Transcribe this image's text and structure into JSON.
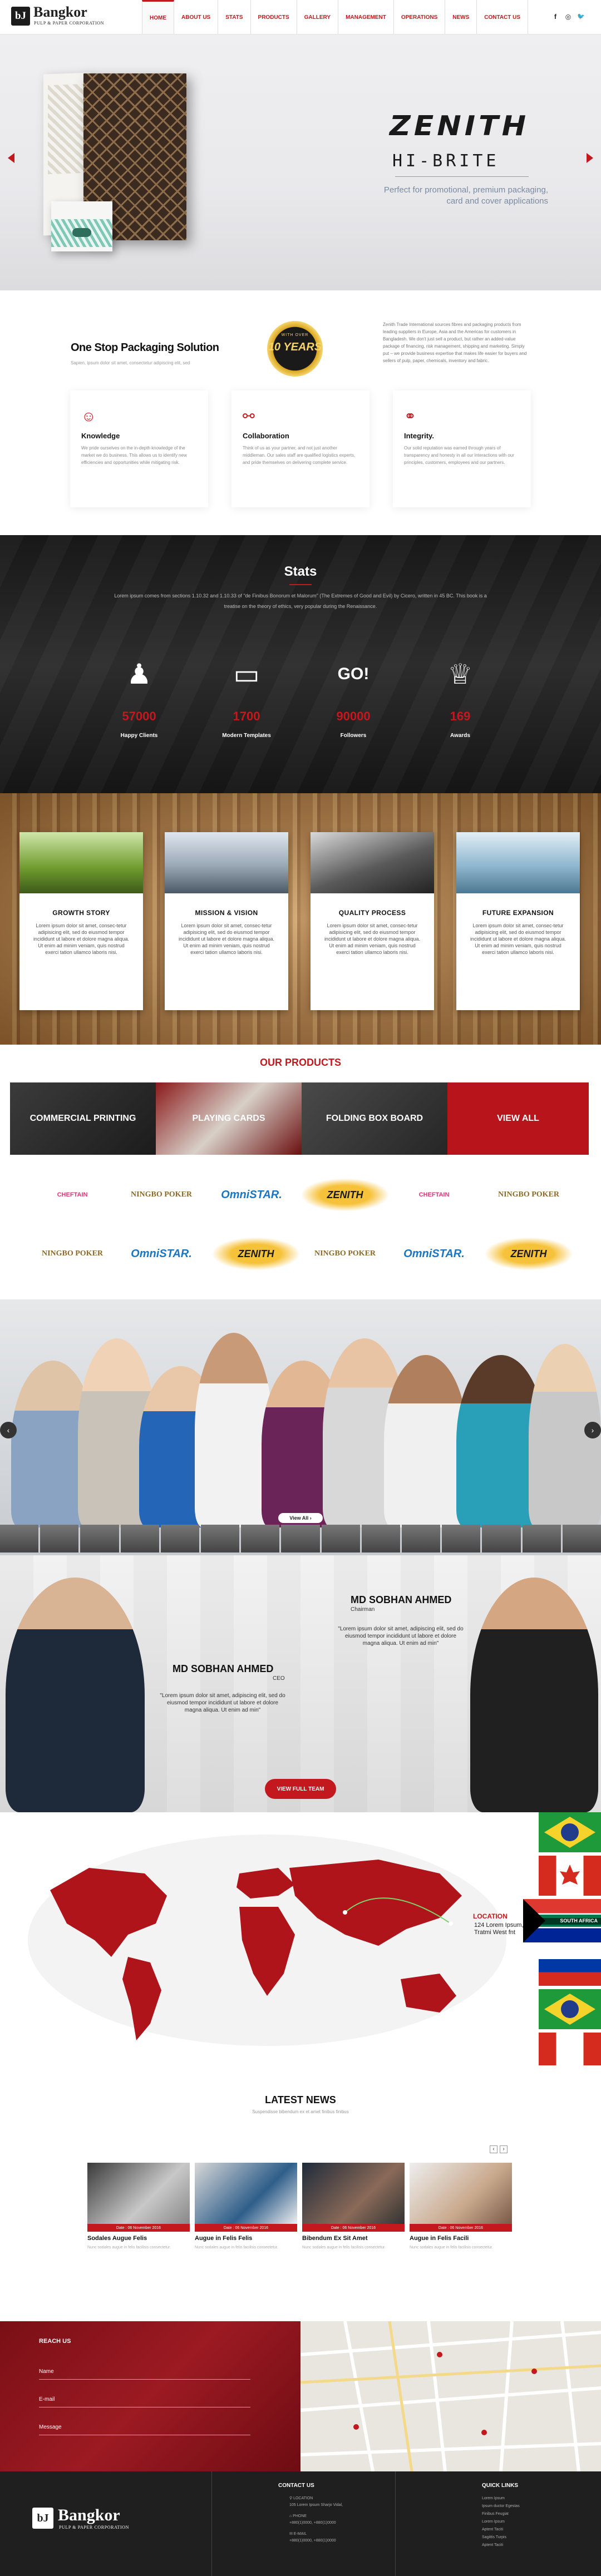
{
  "header": {
    "logo_mark": "bJ",
    "logo_name": "Bangkor",
    "logo_sub": "PULP & PAPER CORPORATION",
    "nav": [
      "HOME",
      "ABOUT US",
      "STATS",
      "PRODUCTS",
      "GALLERY",
      "MANAGEMENT",
      "OPERATIONS",
      "NEWS",
      "CONTACT US"
    ],
    "active_nav": "HOME",
    "social": [
      "f",
      "◎",
      "🐦"
    ]
  },
  "hero": {
    "title": "ZENITH",
    "subtitle": "HI-BRITE",
    "tagline": "Perfect for promotional, premium packaging, card and cover applications",
    "accent": "#c3181e"
  },
  "packaging": {
    "title": "One Stop Packaging Solution",
    "small": "Sapien, ipsum dolor sit amet, consectetur adipiscing elit, sed",
    "badge_top": "WITH OVER",
    "badge_years": "10 YEARS",
    "para": "Zenith Trade International sources fibres and packaging products from leading suppliers in Europe, Asia and the Americas for customers in Bangladesh. We don't just sell a product, but rather an added-value package of financing, risk management, shipping and marketing. Simply put – we provide business expertise that makes life easier for buyers and sellers of pulp, paper, chemicals, inventory and fabric.",
    "cards": [
      {
        "icon": "head-icon",
        "title": "Knowledge",
        "text": "We pride ourselves on the in-depth knowledge of the market we do business. This allows us to identify new efficiencies and opportunities while mitigating risk."
      },
      {
        "icon": "handshake-icon",
        "title": "Collaboration",
        "text": "Think of us as your partner, and not just another middleman. Our sales staff are qualified logistics experts, and pride themselves on delivering complete service."
      },
      {
        "icon": "integrity-icon",
        "title": "Integrity.",
        "text": "Our solid reputation was earned through years of transparency and honesty in all our interactions with our principles, customers, employees and our partners."
      }
    ]
  },
  "stats": {
    "title": "Stats",
    "desc": "Lorem ipsum comes from sections 1.10.32 and 1.10.33 of \"de Finibus Bonorum et Malorum\" (The Extremes of Good and Evil) by Cicero, written in 45 BC. This book is a treatise on the theory of ethics, very popular during the Renaissance.",
    "items": [
      {
        "icon": "users-icon",
        "value": "57000",
        "label": "Happy Clients"
      },
      {
        "icon": "monitor-icon",
        "value": "1700",
        "label": "Modern Templates"
      },
      {
        "icon": "megaphone-icon",
        "value": "90000",
        "label": "Followers"
      },
      {
        "icon": "trophy-icon",
        "value": "169",
        "label": "Awards"
      }
    ]
  },
  "story": [
    {
      "title": "GROWTH STORY",
      "text": "Lorem ipsum dolor sit amet, consec-tetur adipisicing elit, sed do eiusmod tempor incididunt ut labore et dolore magna aliqua. Ut enim ad minim veniam, quis nostrud exerci tation ullamco laboris nisi."
    },
    {
      "title": "MISSION & VISION",
      "text": "Lorem ipsum dolor sit amet, consec-tetur adipisicing elit, sed do eiusmod tempor incididunt ut labore et dolore magna aliqua. Ut enim ad minim veniam, quis nostrud exerci tation ullamco laboris nisi."
    },
    {
      "title": "QUALITY PROCESS",
      "text": "Lorem ipsum dolor sit amet, consec-tetur adipisicing elit, sed do eiusmod tempor incididunt ut labore et dolore magna aliqua. Ut enim ad minim veniam, quis nostrud exerci tation ullamco laboris nisi."
    },
    {
      "title": "FUTURE EXPANSION",
      "text": "Lorem ipsum dolor sit amet, consec-tetur adipisicing elit, sed do eiusmod tempor incididunt ut labore et dolore magna aliqua. Ut enim ad minim veniam, quis nostrud exerci tation ullamco laboris nisi."
    }
  ],
  "products": {
    "title": "OUR PRODUCTS",
    "bands": [
      "COMMERCIAL PRINTING",
      "PLAYING CARDS",
      "FOLDING BOX BOARD",
      "VIEW ALL"
    ],
    "brands_row1": [
      "CHEFTAIN",
      "NINGBO POKER",
      "OmniSTAR.",
      "ZENITH",
      "CHEFTAIN",
      "NINGBO POKER"
    ],
    "brands_row2": [
      "NINGBO POKER",
      "OmniSTAR.",
      "ZENITH",
      "NINGBO POKER",
      "OmniSTAR.",
      "ZENITH"
    ]
  },
  "team": {
    "view_all": "View All ›",
    "prev": "‹",
    "next": "›"
  },
  "leaders": [
    {
      "name": "MD SOBHAN AHMED",
      "role": "Chairman",
      "quote": "\"Lorem ipsum dolor sit amet, adipiscing elit, sed do eiusmod tempor incididunt ut labore et dolore magna aliqua. Ut enim ad min\""
    },
    {
      "name": "MD SOBHAN AHMED",
      "role": "CEO",
      "quote": "\"Lorem ipsum dolor sit amet, adipiscing elit, sed do eiusmod tempor incididunt ut labore et dolore magna aliqua. Ut enim ad min\""
    }
  ],
  "view_full_team": "VIEW FULL TEAM",
  "location": {
    "title": "LOCATION",
    "address": "124 Lorem Ipsum, Tratmi West fnt",
    "country": "SOUTH AFRICA"
  },
  "news": {
    "title": "LATEST NEWS",
    "sub": "Suspendisse bibendum ex et amet finibus finibus",
    "items": [
      {
        "date": "Date : 06 November 2016",
        "title": "Sodales Augue Felis",
        "text": "Nunc sodales augue in felis facilisis consectetur."
      },
      {
        "date": "Date : 06 November 2016",
        "title": "Augue in Felis Felis",
        "text": "Nunc sodales augue in felis facilisis consectetur."
      },
      {
        "date": "Date : 06 November 2016",
        "title": "Bibendum Ex Sit Amet",
        "text": "Nunc sodales augue in felis facilisis consectetur."
      },
      {
        "date": "Date : 06 November 2016",
        "title": "Augue in Felis Facili",
        "text": "Nunc sodales augue in felis facilisis consectetur."
      }
    ]
  },
  "reach": {
    "title": "REACH US",
    "fields": [
      "Name",
      "E-mail",
      "Message"
    ]
  },
  "footer": {
    "logo_name": "Bangkor",
    "logo_sub": "PULP & PAPER CORPORATION",
    "contact_title": "CONTACT US",
    "contact_lines": [
      "⚲ LOCATION",
      "105 Lorem Ipsum Sharjo Vidal,",
      "⌂ PHONE",
      "+880(1)0000, +880(1)0000",
      "✉ E-MAIL",
      "+880(1)0000, +880(1)0000"
    ],
    "links_title": "QUICK LINKS",
    "links": [
      "Lorem Ipsum",
      "Ipsum ductor Egestas",
      "Finibus Feugiat",
      "Lorem Ipsum",
      "Aptent Taciti",
      "Sagittis Turpis",
      "Aptent Taciti"
    ]
  }
}
